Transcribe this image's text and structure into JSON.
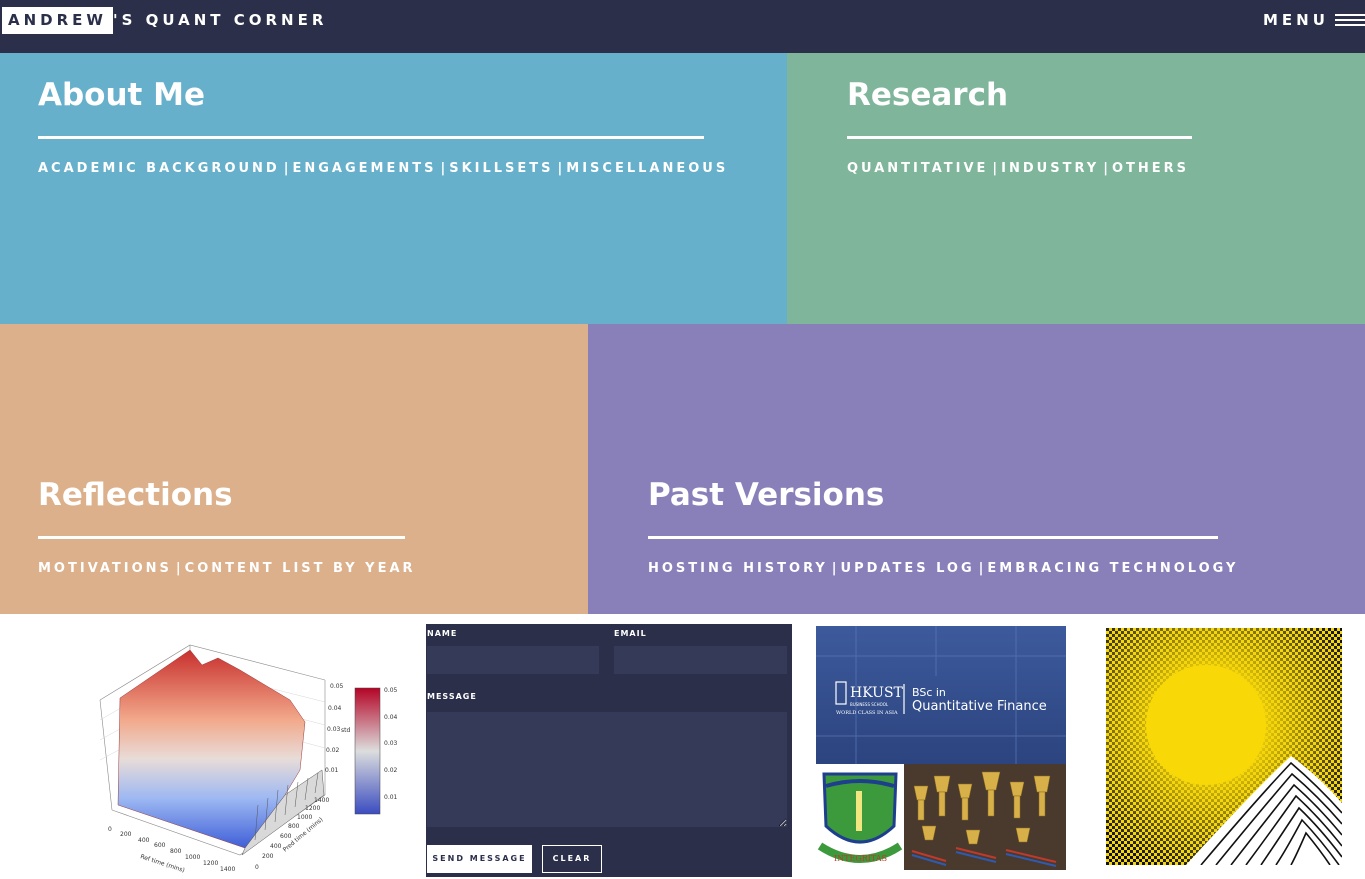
{
  "header": {
    "logo_box": "ANDREW",
    "logo_rest": "'S QUANT CORNER",
    "menu_label": "MENU"
  },
  "tiles": {
    "about": {
      "title": "About Me",
      "links": [
        "ACADEMIC BACKGROUND",
        "ENGAGEMENTS",
        "SKILLSETS",
        "MISCELLANEOUS"
      ],
      "color": "#67b0cb"
    },
    "research": {
      "title": "Research",
      "links": [
        "QUANTITATIVE",
        "INDUSTRY",
        "OTHERS"
      ],
      "color": "#7fb59b"
    },
    "reflections": {
      "title": "Reflections",
      "links": [
        "MOTIVATIONS",
        "CONTENT LIST BY YEAR"
      ],
      "color": "#dbb08b"
    },
    "past": {
      "title": "Past Versions",
      "links": [
        "HOSTING HISTORY",
        "UPDATES LOG",
        "EMBRACING TECHNOLOGY"
      ],
      "color": "#8a80b9"
    },
    "separator": "|"
  },
  "surface_plot": {
    "colorbar_ticks": [
      "0.05",
      "0.04",
      "0.03",
      "0.02",
      "0.01"
    ],
    "z_ticks": [
      "0.05",
      "0.04",
      "0.03",
      "0.02",
      "0.01"
    ],
    "z_label": "std",
    "x_ticks": [
      "0",
      "200",
      "400",
      "600",
      "800",
      "1000",
      "1200",
      "1400"
    ],
    "x_label": "Ref time (mins)",
    "y_ticks": [
      "0",
      "200",
      "400",
      "600",
      "800",
      "1000",
      "1200",
      "1400"
    ],
    "y_label": "Pred time (mins)"
  },
  "contact_form": {
    "name_label": "NAME",
    "email_label": "EMAIL",
    "message_label": "MESSAGE",
    "send_label": "SEND MESSAGE",
    "clear_label": "CLEAR"
  },
  "collage": {
    "school_name": "HKUST",
    "school_sub": "BUSINESS SCHOOL",
    "school_tagline": "WORLD CLASS IN ASIA",
    "program_line1": "BSc in",
    "program_line2": "Quantitative Finance",
    "crest_motto": "INTEGRITAS"
  },
  "colors": {
    "navy": "#2b2f4a",
    "about": "#67b0cb",
    "research": "#7fb59b",
    "reflections": "#dbb08b",
    "past": "#8a80b9",
    "pattern_yellow": "#f5d60a"
  }
}
